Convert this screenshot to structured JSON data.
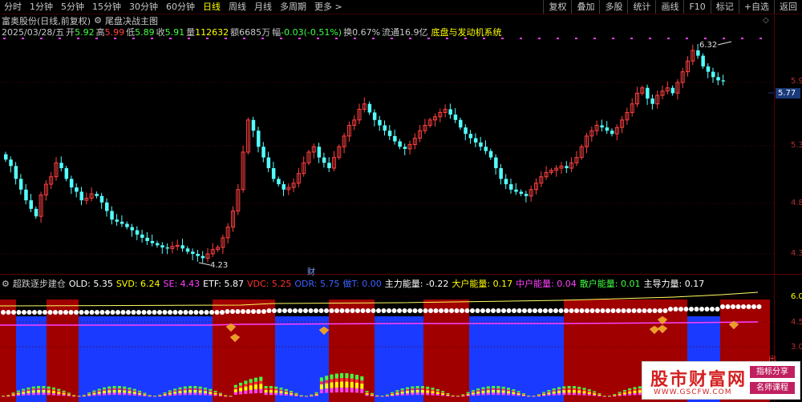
{
  "toolbar": {
    "periods": [
      "分时",
      "1分钟",
      "5分钟",
      "15分钟",
      "30分钟",
      "60分钟",
      "日线",
      "周线",
      "月线",
      "多周期",
      "更多 >"
    ],
    "active_index": 6,
    "right_buttons": [
      "复权",
      "叠加",
      "多股",
      "统计",
      "画线",
      "F10",
      "标记",
      "+自选",
      "返回"
    ]
  },
  "title": {
    "stock": "富奥股份(日线,前复权)",
    "indicator_icon": "gear-icon",
    "indicator": "尾盘决战主图"
  },
  "quote": {
    "date": "2025/03/28/五",
    "open_label": "开",
    "open": "5.92",
    "high_label": "高",
    "high": "5.99",
    "low_label": "低",
    "low": "5.89",
    "close_label": "收",
    "close": "5.91",
    "vol_label": "量",
    "vol": "112632",
    "amount_label": "额",
    "amount": "6685万",
    "change_label": "幅",
    "change": "-0.03(-0.51%)",
    "turnover_label": "换",
    "turnover": "0.67%",
    "float_label": "流通",
    "float": "16.9亿",
    "system": "底盘与发动机系统"
  },
  "price_axis": {
    "ticks": [
      "5.9",
      "5.3",
      "4.8",
      "4.3"
    ],
    "current": "5.77",
    "annotation_high": "6.32",
    "annotation_low": "4.23",
    "cai_marker": "财"
  },
  "indicator_panel": {
    "name": "超跌逐步建仓",
    "items": [
      {
        "label": "OLD:",
        "value": "5.35",
        "color": "#ffffff"
      },
      {
        "label": "SVD:",
        "value": "6.24",
        "color": "#ffff00"
      },
      {
        "label": "SE:",
        "value": "4.43",
        "color": "#ff40ff"
      },
      {
        "label": "ETF:",
        "value": "5.87",
        "color": "#ffffff"
      },
      {
        "label": "VDC:",
        "value": "5.25",
        "color": "#ff3030"
      },
      {
        "label": "ODR:",
        "value": "5.75",
        "color": "#4060ff"
      },
      {
        "label": "做T:",
        "value": "0.00",
        "color": "#4060ff"
      },
      {
        "label": "主力能量:",
        "value": "-0.22",
        "color": "#ffffff"
      },
      {
        "label": "大户能量:",
        "value": "0.17",
        "color": "#ffff00"
      },
      {
        "label": "中户能量:",
        "value": "0.04",
        "color": "#ff40ff"
      },
      {
        "label": "散户能量:",
        "value": "0.01",
        "color": "#40ff40"
      },
      {
        "label": "主导力量:",
        "value": "0.17",
        "color": "#ffffff"
      }
    ],
    "ticks": [
      "6.0",
      "4.5",
      "3.0"
    ],
    "corner": "出"
  },
  "watermark": {
    "main": "股市财富网",
    "url": "WWW.GSCFW.COM",
    "tag1": "指标分享",
    "tag2": "名师课程"
  },
  "colors": {
    "up": "#ff4040",
    "down": "#54ffff",
    "band_red": "#a00000",
    "band_blue": "#1a3aff"
  }
}
